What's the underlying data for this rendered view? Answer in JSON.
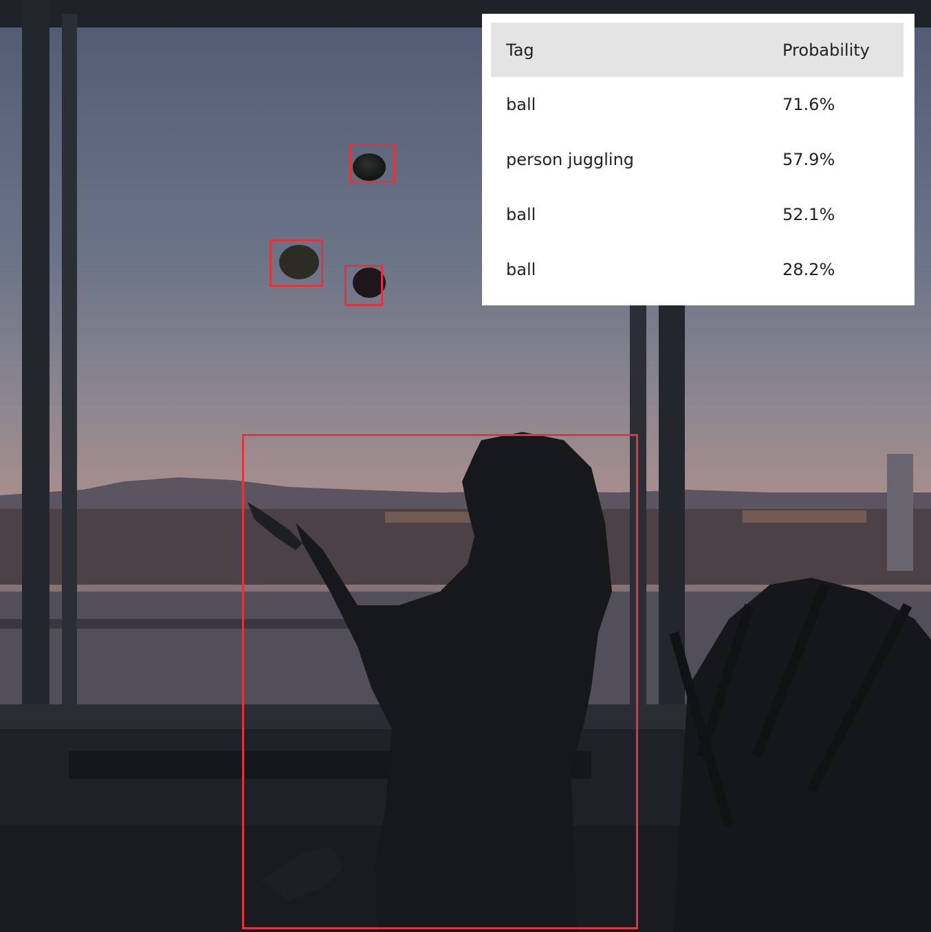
{
  "tag_table": {
    "headers": {
      "tag": "Tag",
      "probability": "Probability"
    },
    "rows": [
      {
        "tag": "ball",
        "probability": "71.6%"
      },
      {
        "tag": "person juggling",
        "probability": "57.9%"
      },
      {
        "tag": "ball",
        "probability": "52.1%"
      },
      {
        "tag": "ball",
        "probability": "28.2%"
      }
    ]
  },
  "colors": {
    "detection_box": "#e0343e",
    "table_header_bg": "#e4e4e4",
    "panel_bg": "#ffffff",
    "text": "#222222"
  },
  "scene": {
    "subject": "person juggling three balls in front of a window at dusk",
    "detections": [
      {
        "label": "ball"
      },
      {
        "label": "ball"
      },
      {
        "label": "ball"
      },
      {
        "label": "person juggling"
      }
    ]
  }
}
